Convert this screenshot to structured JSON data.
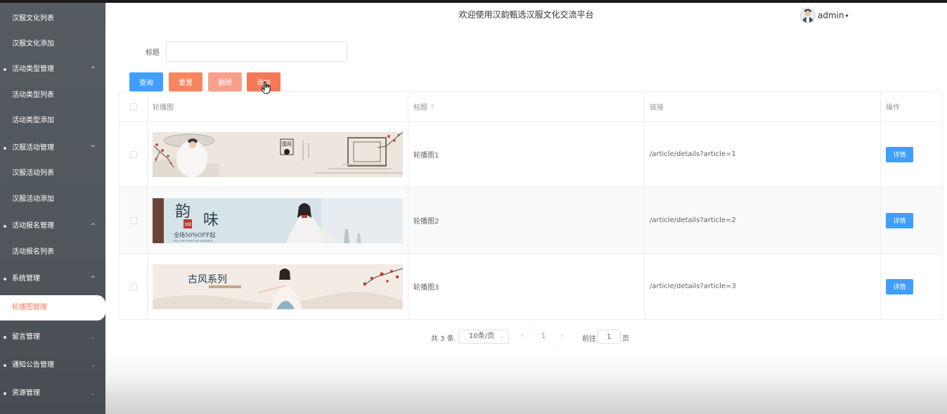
{
  "sidebar": {
    "items": [
      {
        "label": "汉服文化列表",
        "kind": "sub"
      },
      {
        "label": "汉服文化添加",
        "kind": "sub"
      },
      {
        "label": "活动类型管理",
        "kind": "group",
        "chevron": "^"
      },
      {
        "label": "活动类型列表",
        "kind": "sub"
      },
      {
        "label": "活动类型添加",
        "kind": "sub"
      },
      {
        "label": "汉服活动管理",
        "kind": "group",
        "chevron": "^"
      },
      {
        "label": "汉服活动列表",
        "kind": "sub"
      },
      {
        "label": "汉服活动添加",
        "kind": "sub"
      },
      {
        "label": "活动报名管理",
        "kind": "group",
        "chevron": "^"
      },
      {
        "label": "活动报名列表",
        "kind": "sub"
      },
      {
        "label": "系统管理",
        "kind": "group",
        "chevron": "^"
      },
      {
        "label": "轮播图管理",
        "kind": "sub",
        "active": true
      },
      {
        "label": "留言管理",
        "kind": "group",
        "chevron": "⌄"
      },
      {
        "label": "通知公告管理",
        "kind": "group",
        "chevron": "⌄"
      },
      {
        "label": "资源管理",
        "kind": "group",
        "chevron": "⌄"
      }
    ]
  },
  "header": {
    "title": "欢迎使用汉韵甄选汉服文化交流平台",
    "user": {
      "name": "admin",
      "caret": "▾"
    }
  },
  "search": {
    "label": "标题",
    "value": "",
    "placeholder": ""
  },
  "toolbar": {
    "query_label": "查询",
    "reset_label": "重置",
    "delete_label": "删除",
    "add_label": "添加"
  },
  "table": {
    "headers": {
      "image": "轮播图",
      "title": "标题",
      "sort_icon": "⇕",
      "link": "链接",
      "action": "操作"
    },
    "rows": [
      {
        "title": "轮播图1",
        "link": "/article/details?article=1",
        "action_label": "详情",
        "banner": "guofeng-umbrella"
      },
      {
        "title": "轮播图2",
        "link": "/article/details?article=2",
        "action_label": "详情",
        "banner": "yunwei-sale",
        "banner_text": {
          "big1": "韵",
          "big2": "味",
          "sub": "全场50%OFF起",
          "tiny": "50% OFF FROM THE AUDIENCE",
          "stamp": "汉服"
        }
      },
      {
        "title": "轮播图3",
        "link": "/article/details?article=3",
        "action_label": "详情",
        "banner": "gufeng-series",
        "banner_text": {
          "big": "古风系列"
        }
      }
    ]
  },
  "pagination": {
    "total": "共 3 条",
    "page_size": "10条/页",
    "page_size_arrow": "⌄",
    "prev": "‹",
    "current": "1",
    "next": "›",
    "goto_label": "前往",
    "goto_value": "1",
    "goto_unit": "页"
  },
  "colors": {
    "primary": "#409eff",
    "accent": "#f47855",
    "sidebar": "#50575c"
  }
}
